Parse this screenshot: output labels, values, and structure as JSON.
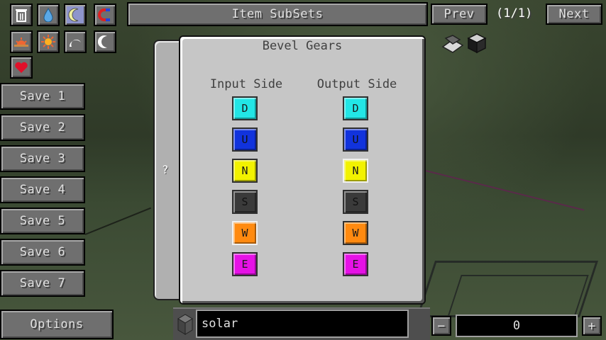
{
  "top_bar": {
    "item_subsets_label": "Item SubSets",
    "prev_label": "Prev",
    "page_indicator": "(1/1)",
    "next_label": "Next"
  },
  "left_icons": [
    {
      "name": "trash-icon",
      "selected": false
    },
    {
      "name": "water-drop-icon",
      "selected": false
    },
    {
      "name": "crescent-moon-icon",
      "selected": true
    },
    {
      "name": "magnet-icon",
      "selected": false
    },
    {
      "name": "sunrise-icon",
      "selected": false
    },
    {
      "name": "sun-icon",
      "selected": false
    },
    {
      "name": "setting-moon-icon",
      "selected": false
    },
    {
      "name": "moon-icon",
      "selected": false
    },
    {
      "name": "heart-icon",
      "selected": false
    }
  ],
  "save_slots": [
    "Save 1",
    "Save 2",
    "Save 3",
    "Save 4",
    "Save 5",
    "Save 6",
    "Save 7"
  ],
  "options_label": "Options",
  "panel": {
    "tab_label": "?",
    "title": "Bevel Gears",
    "input_side_label": "Input Side",
    "output_side_label": "Output Side",
    "directions": [
      {
        "letter": "D",
        "color": "#22e6e6",
        "input_active": false,
        "output_active": false
      },
      {
        "letter": "U",
        "color": "#1133dd",
        "input_active": false,
        "output_active": false
      },
      {
        "letter": "N",
        "color": "#f2f200",
        "input_active": false,
        "output_active": true
      },
      {
        "letter": "S",
        "color": "#3a3a3a",
        "input_active": false,
        "output_active": false
      },
      {
        "letter": "W",
        "color": "#ff8a10",
        "input_active": true,
        "output_active": false
      },
      {
        "letter": "E",
        "color": "#e612e6",
        "input_active": false,
        "output_active": false
      }
    ]
  },
  "search": {
    "value": "solar"
  },
  "amount": {
    "value": "0",
    "minus_label": "−",
    "plus_label": "+"
  }
}
